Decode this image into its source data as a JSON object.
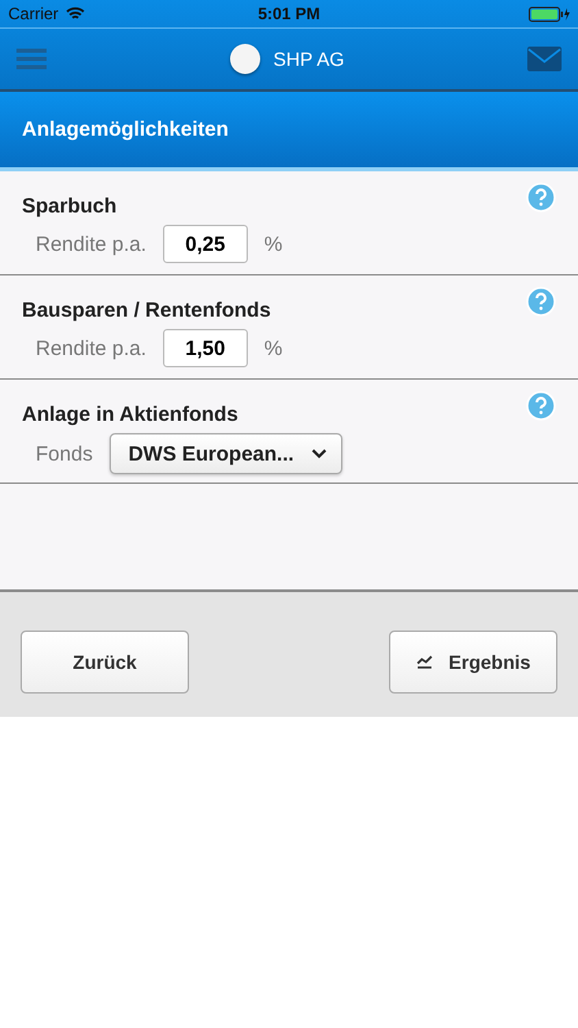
{
  "status_bar": {
    "carrier": "Carrier",
    "time": "5:01 PM"
  },
  "header": {
    "title": "SHP AG"
  },
  "section_title": "Anlagemöglichkeiten",
  "items": [
    {
      "kind": "rate",
      "title": "Sparbuch",
      "label": "Rendite p.a.",
      "value": "0,25",
      "unit": "%"
    },
    {
      "kind": "rate",
      "title": "Bausparen / Rentenfonds",
      "label": "Rendite p.a.",
      "value": "1,50",
      "unit": "%"
    },
    {
      "kind": "select",
      "title": "Anlage in Aktienfonds",
      "label": "Fonds",
      "value": "DWS European..."
    }
  ],
  "buttons": {
    "back": "Zurück",
    "result": "Ergebnis"
  }
}
